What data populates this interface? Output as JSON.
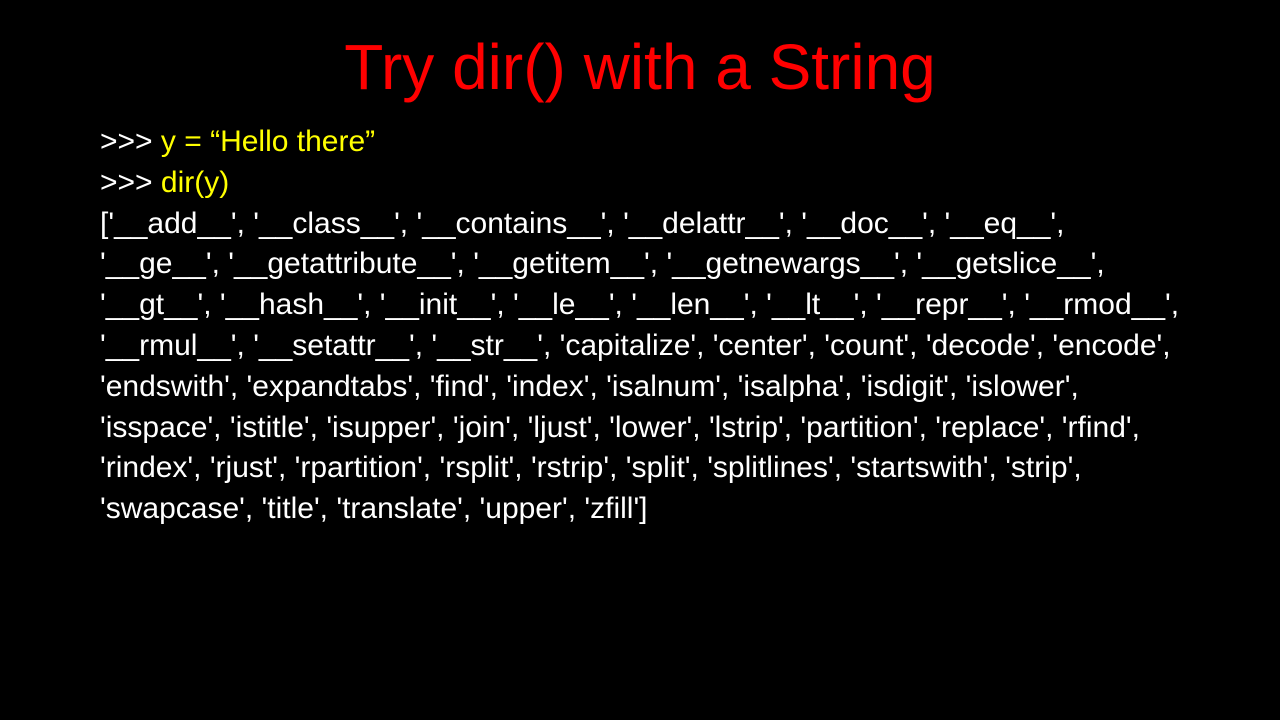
{
  "title": "Try dir() with a String",
  "line1_prompt": ">>> ",
  "line1_code": "y = “Hello there”",
  "line2_prompt": ">>> ",
  "line2_code": "dir(y)",
  "output": "['__add__', '__class__', '__contains__', '__delattr__', '__doc__', '__eq__', '__ge__', '__getattribute__', '__getitem__', '__getnewargs__', '__getslice__', '__gt__', '__hash__', '__init__', '__le__', '__len__', '__lt__', '__repr__', '__rmod__', '__rmul__', '__setattr__', '__str__', 'capitalize', 'center', 'count', 'decode', 'encode', 'endswith', 'expandtabs', 'find', 'index', 'isalnum', 'isalpha', 'isdigit', 'islower', 'isspace', 'istitle', 'isupper', 'join', 'ljust', 'lower', 'lstrip', 'partition', 'replace', 'rfind', 'rindex', 'rjust', 'rpartition', 'rsplit', 'rstrip', 'split', 'splitlines', 'startswith', 'strip', 'swapcase', 'title', 'translate', 'upper', 'zfill']"
}
